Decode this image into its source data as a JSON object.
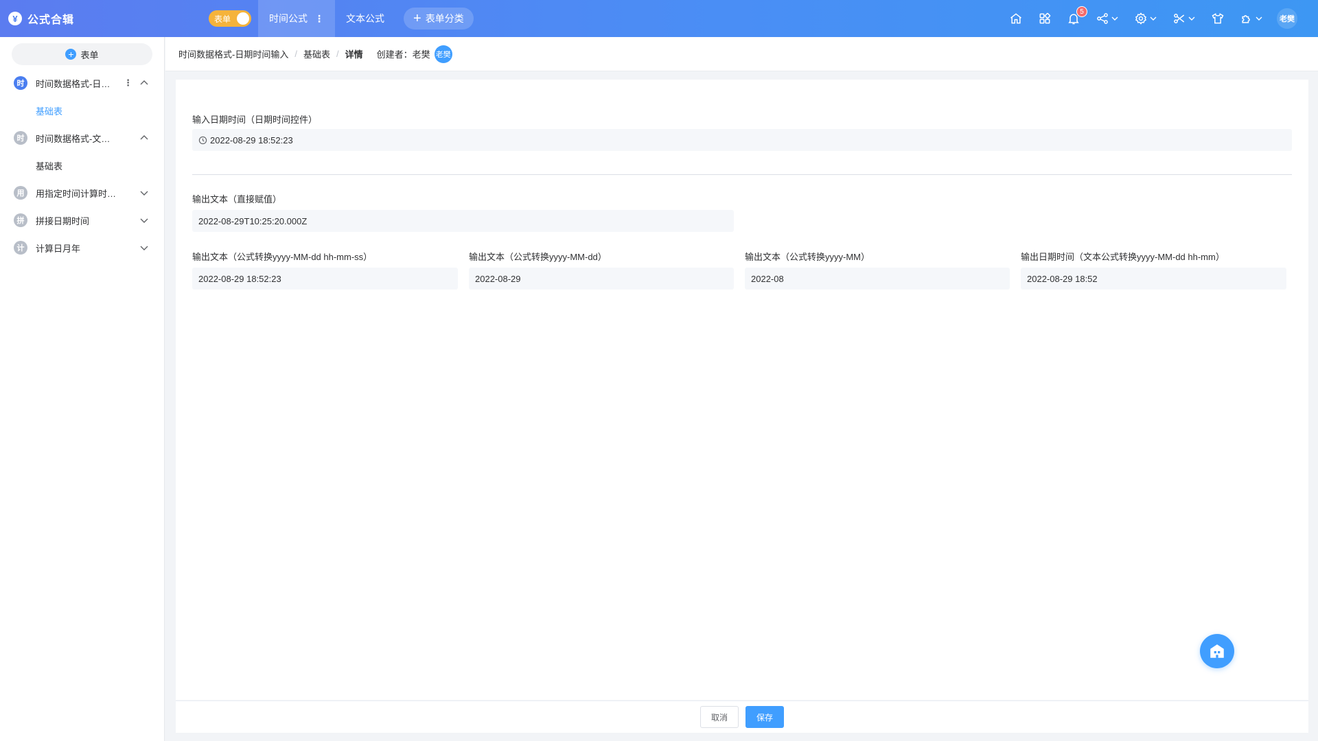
{
  "app": {
    "logo_glyph": "¥",
    "title": "公式合辑",
    "mode_toggle_label": "表单"
  },
  "nav": {
    "tabs": [
      {
        "label": "时间公式",
        "more": "⋮"
      },
      {
        "label": "文本公式"
      }
    ],
    "add_category_label": "表单分类",
    "notification_count": "5",
    "user_avatar_text": "老樊",
    "icons": [
      "home-icon",
      "apps-grid-icon",
      "bell-icon",
      "share-icon",
      "settings-icon",
      "tools-icon",
      "shirt-icon",
      "plugin-icon"
    ]
  },
  "sidebar": {
    "new_form_label": "表单",
    "groups": [
      {
        "icon": "时",
        "label": "时间数据格式-日期时间输入",
        "more": "⋮",
        "sub": [
          {
            "label": "基础表"
          }
        ]
      },
      {
        "icon": "时",
        "label": "时间数据格式-文本输入",
        "sub": [
          {
            "label": "基础表"
          }
        ]
      },
      {
        "icon": "用",
        "label": "用指定时间计算时间差"
      },
      {
        "icon": "拼",
        "label": "拼接日期时间"
      },
      {
        "icon": "计",
        "label": "计算日月年"
      }
    ]
  },
  "breadcrumb": {
    "items": [
      "时间数据格式-日期时间输入",
      "基础表",
      "详情"
    ],
    "creator_label": "创建者：老樊",
    "creator_avatar": "老樊"
  },
  "form": {
    "input_datetime": {
      "label": "输入日期时间（日期时间控件）",
      "value": "2022-08-29 18:52:23"
    },
    "output_direct": {
      "label": "输出文本（直接赋值）",
      "value": "2022-08-29T10:25:20.000Z"
    },
    "output_fields": [
      {
        "label": "输出文本（公式转换yyyy-MM-dd hh-mm-ss）",
        "value": "2022-08-29 18:52:23"
      },
      {
        "label": "输出文本（公式转换yyyy-MM-dd）",
        "value": "2022-08-29"
      },
      {
        "label": "输出文本（公式转换yyyy-MM）",
        "value": "2022-08"
      },
      {
        "label": "输出日期时间（文本公式转换yyyy-MM-dd hh-mm）",
        "value": "2022-08-29 18:52"
      }
    ]
  },
  "footer": {
    "cancel_label": "取消",
    "save_label": "保存"
  },
  "colors": {
    "accent": "#409eff",
    "header_start": "#5b7cf0",
    "header_end": "#3d97f3",
    "toggle": "#f5b33b",
    "badge": "#f56c6c"
  }
}
